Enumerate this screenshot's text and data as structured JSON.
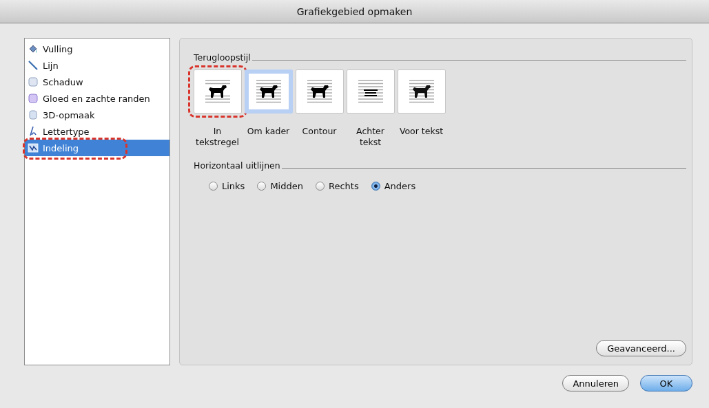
{
  "window": {
    "title": "Grafiekgebied opmaken"
  },
  "sidebar": {
    "items": [
      {
        "label": "Vulling",
        "kind": "fill",
        "selected": false,
        "highlighted": false
      },
      {
        "label": "Lijn",
        "kind": "line",
        "selected": false,
        "highlighted": false
      },
      {
        "label": "Schaduw",
        "kind": "shadow",
        "selected": false,
        "highlighted": false
      },
      {
        "label": "Gloed en zachte randen",
        "kind": "glow",
        "selected": false,
        "highlighted": false
      },
      {
        "label": "3D-opmaak",
        "kind": "cube",
        "selected": false,
        "highlighted": false
      },
      {
        "label": "Lettertype",
        "kind": "font",
        "selected": false,
        "highlighted": false
      },
      {
        "label": "Indeling",
        "kind": "layout",
        "selected": true,
        "highlighted": true
      }
    ]
  },
  "wrap_style": {
    "heading": "Terugloopstijl",
    "options": [
      {
        "label": "In tekstregel",
        "kind": "inline",
        "selected": false,
        "highlighted": true
      },
      {
        "label": "Om kader",
        "kind": "square",
        "selected": true,
        "highlighted": false
      },
      {
        "label": "Contour",
        "kind": "tight",
        "selected": false,
        "highlighted": false
      },
      {
        "label": "Achter tekst",
        "kind": "behind",
        "selected": false,
        "highlighted": false
      },
      {
        "label": "Voor tekst",
        "kind": "front",
        "selected": false,
        "highlighted": false
      }
    ]
  },
  "horizontal_align": {
    "heading": "Horizontaal uitlijnen",
    "options": [
      {
        "label": "Links",
        "selected": false
      },
      {
        "label": "Midden",
        "selected": false
      },
      {
        "label": "Rechts",
        "selected": false
      },
      {
        "label": "Anders",
        "selected": true
      }
    ]
  },
  "advanced_button": "Geavanceerd...",
  "buttons": [
    {
      "label": "Annuleren",
      "kind": "cancel"
    },
    {
      "label": "OK",
      "kind": "default"
    }
  ]
}
